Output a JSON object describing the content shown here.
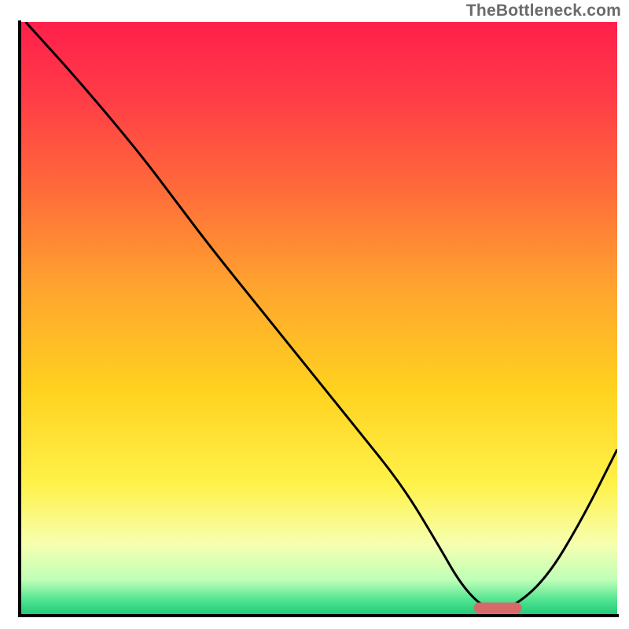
{
  "watermark": "TheBottleneck.com",
  "chart_data": {
    "type": "line",
    "title": "",
    "xlabel": "",
    "ylabel": "",
    "xlim": [
      0,
      100
    ],
    "ylim": [
      0,
      100
    ],
    "background_gradient": {
      "stops": [
        {
          "offset": 0.0,
          "color": "#ff1f4b"
        },
        {
          "offset": 0.12,
          "color": "#ff3a47"
        },
        {
          "offset": 0.28,
          "color": "#ff6a3a"
        },
        {
          "offset": 0.45,
          "color": "#ffa52e"
        },
        {
          "offset": 0.62,
          "color": "#ffd21f"
        },
        {
          "offset": 0.78,
          "color": "#fff24a"
        },
        {
          "offset": 0.88,
          "color": "#f6ffb0"
        },
        {
          "offset": 0.94,
          "color": "#bfffb8"
        },
        {
          "offset": 0.975,
          "color": "#4de38f"
        },
        {
          "offset": 1.0,
          "color": "#1fc776"
        }
      ]
    },
    "series": [
      {
        "name": "bottleneck-curve",
        "color": "#000000",
        "width": 3,
        "x": [
          1,
          10,
          20,
          26,
          32,
          40,
          48,
          56,
          64,
          70,
          74,
          78,
          82,
          88,
          94,
          100
        ],
        "values": [
          100,
          90,
          78,
          70,
          62,
          52,
          42,
          32,
          22,
          12,
          5,
          1,
          1,
          6,
          16,
          28
        ]
      }
    ],
    "marker": {
      "name": "optimal-range",
      "shape": "rounded-bar",
      "color": "#d66a6a",
      "x_start": 76,
      "x_end": 84,
      "y": 1.3,
      "height_pct": 1.8
    },
    "axes": {
      "color": "#000000",
      "width": 4
    }
  }
}
